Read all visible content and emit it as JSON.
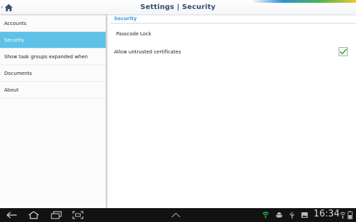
{
  "header": {
    "title": "Settings | Security",
    "back_icon": "chevron-left-icon",
    "home_icon": "home-icon"
  },
  "sidebar": {
    "items": [
      {
        "label": "Accounts",
        "selected": false
      },
      {
        "label": "Security",
        "selected": true
      },
      {
        "label": "Show task groups expanded when",
        "selected": false
      },
      {
        "label": "Documents",
        "selected": false
      },
      {
        "label": "About",
        "selected": false
      }
    ]
  },
  "content": {
    "section_title": "Security",
    "passcode_label": "Passcode Lock",
    "untrusted_label": "Allow untrusted certificates",
    "untrusted_checked": true
  },
  "system_bar": {
    "clock": "16:34",
    "nav_icons": [
      "back-icon",
      "home-icon",
      "recent-apps-icon",
      "screenshot-icon",
      "chevron-up-icon"
    ],
    "status_icons": [
      "vpn-shield-icon",
      "android-icon",
      "usb-icon",
      "gallery-icon",
      "wifi-icon",
      "battery-icon"
    ]
  },
  "colors": {
    "selected_item": "#5ec2e8",
    "section_title": "#3aa1e0",
    "title_text": "#2e4a71",
    "checkmark": "#3aa03f",
    "system_bar": "#121212"
  }
}
